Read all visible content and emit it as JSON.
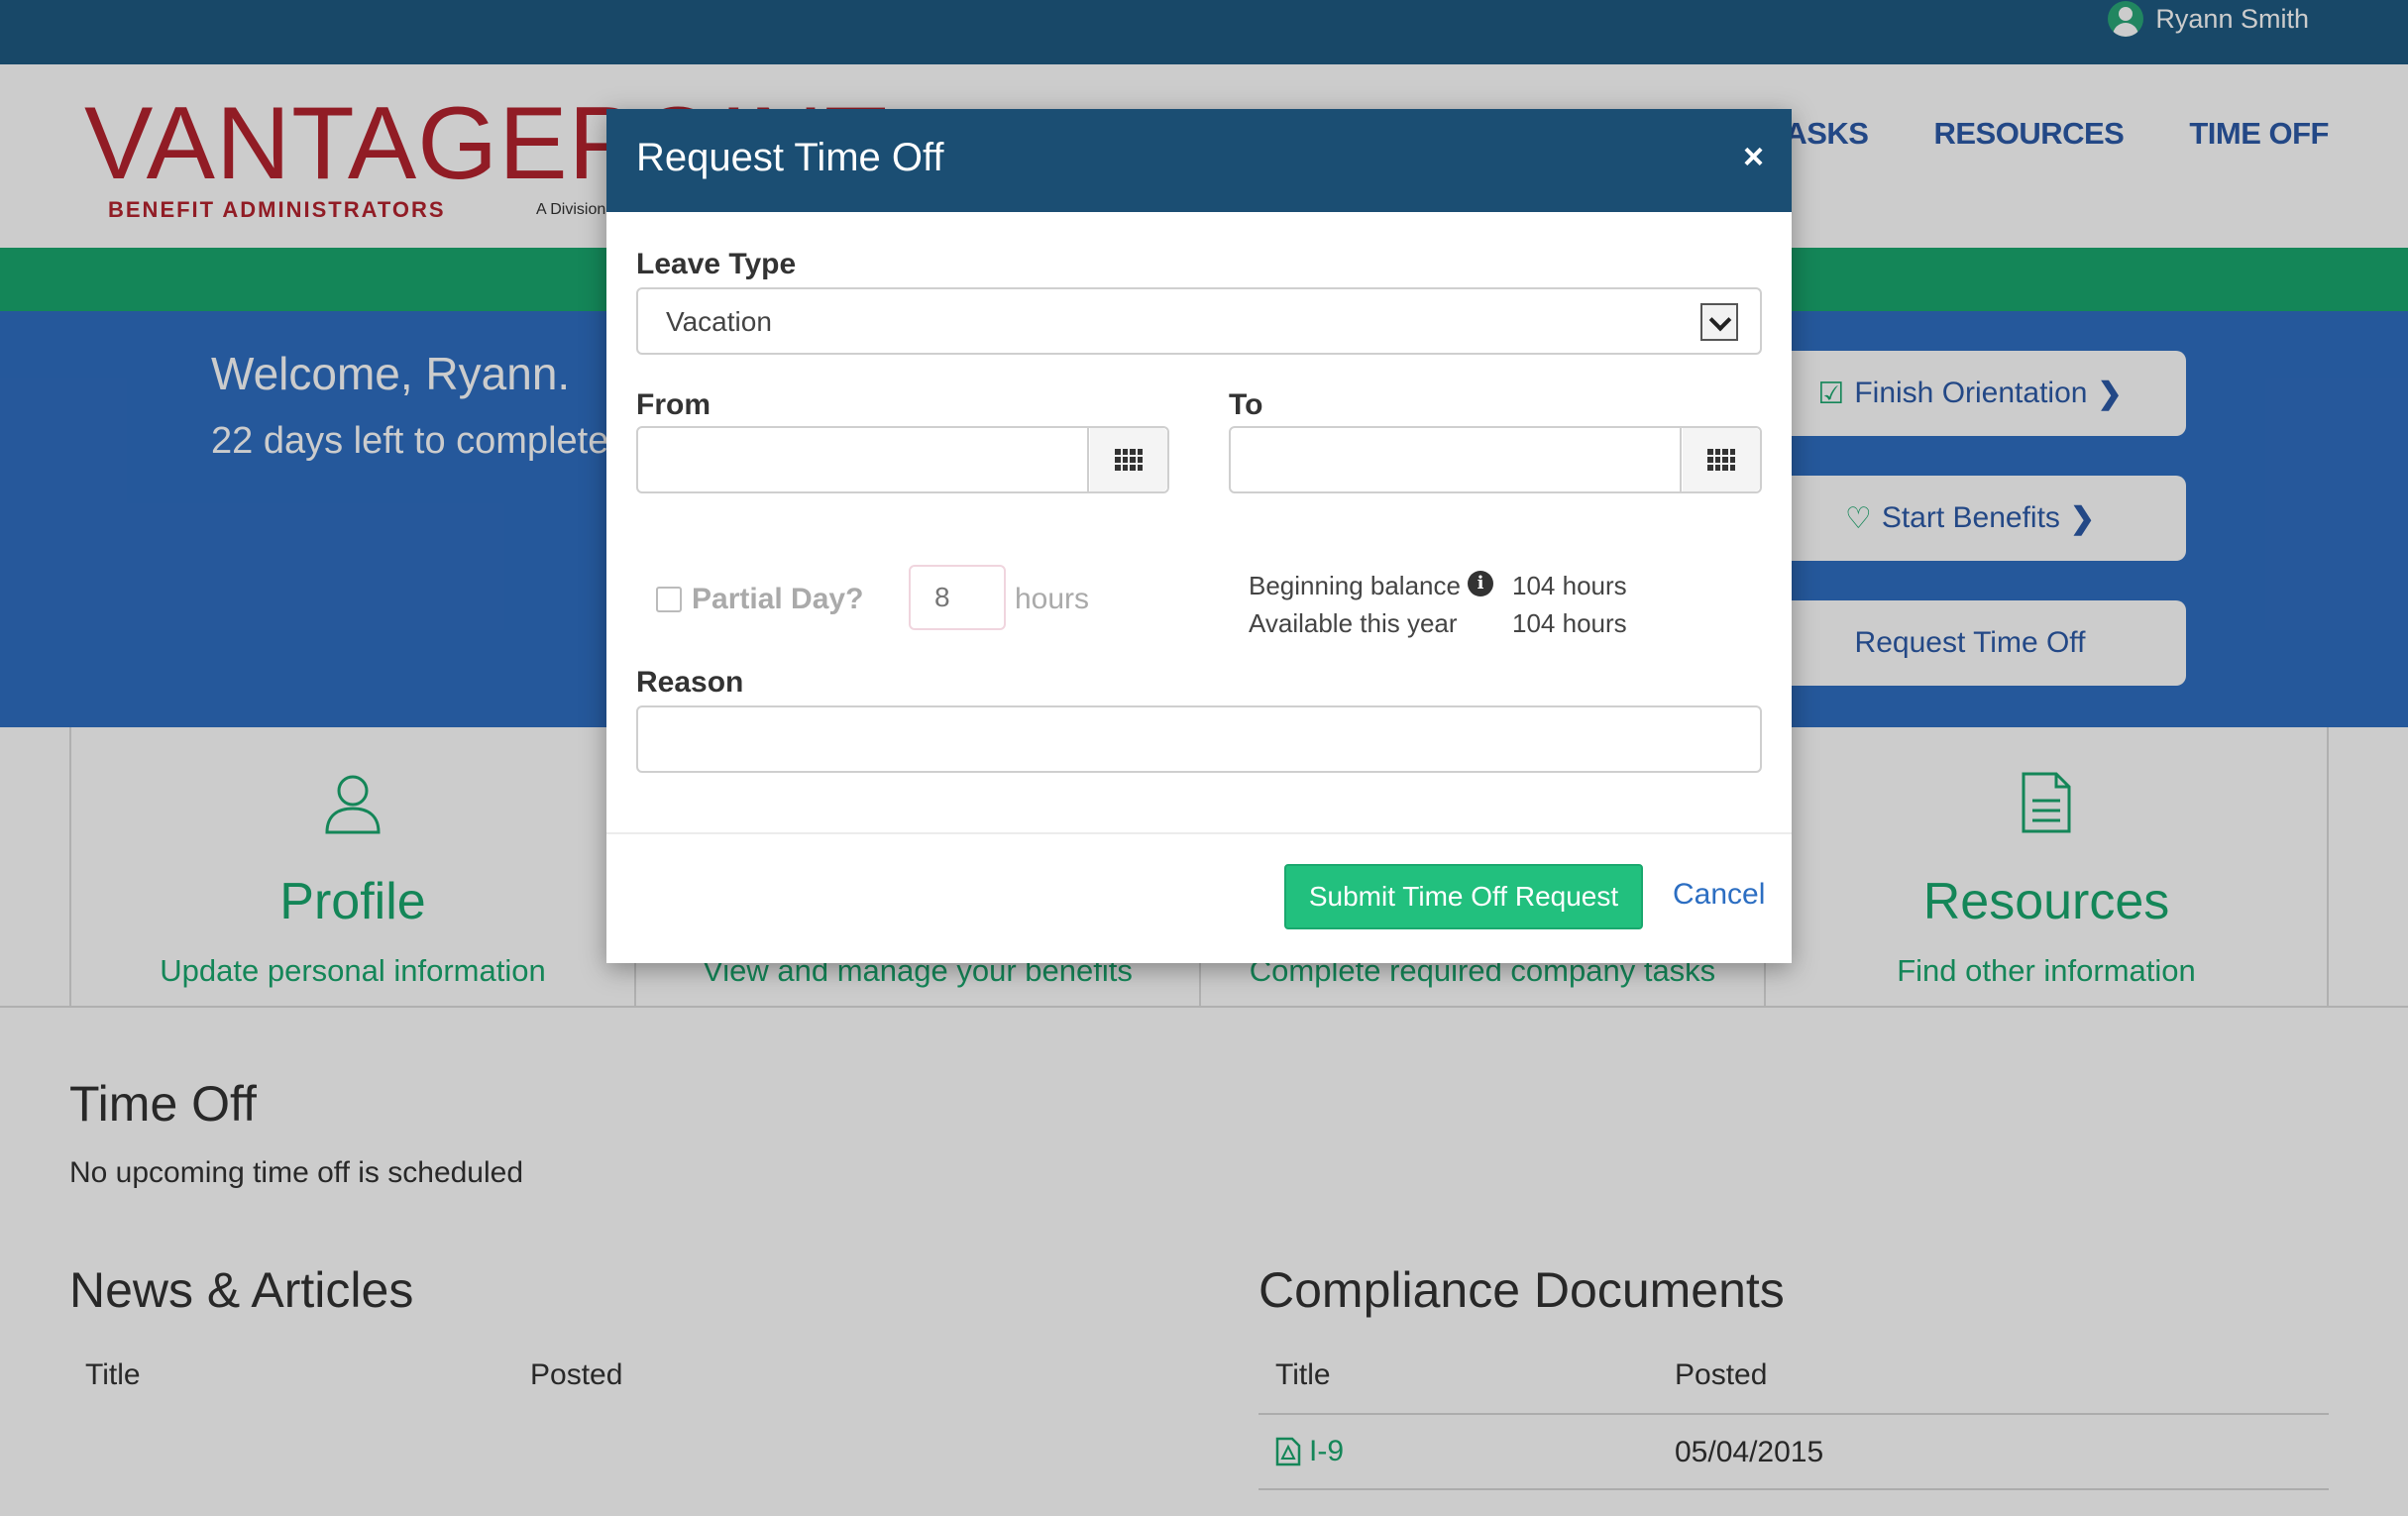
{
  "topbar": {
    "user_name": "Ryann Smith"
  },
  "header": {
    "logo_brand": "VANTAGEPOINT",
    "logo_tagline": "BENEFIT ADMINISTRATORS",
    "logo_division": "A Division",
    "nav": [
      {
        "label": "TASKS"
      },
      {
        "label": "RESOURCES"
      },
      {
        "label": "TIME OFF"
      }
    ]
  },
  "hero": {
    "welcome": "Welcome, Ryann.",
    "days_left": "22 days left to complete",
    "actions": [
      {
        "label": "Finish Orientation",
        "icon": "check-square-icon"
      },
      {
        "label": "Start Benefits",
        "icon": "heart-plus-icon"
      },
      {
        "label": "Request Time Off"
      }
    ]
  },
  "cards": [
    {
      "title": "Profile",
      "subtitle": "Update personal information",
      "icon": "person-icon"
    },
    {
      "title": "",
      "subtitle": "View and manage your benefits"
    },
    {
      "title": "",
      "subtitle": "Complete required company tasks"
    },
    {
      "title": "Resources",
      "subtitle": "Find other information",
      "icon": "document-icon"
    }
  ],
  "time_off": {
    "title": "Time Off",
    "message": "No upcoming time off is scheduled"
  },
  "news": {
    "title": "News & Articles",
    "columns": [
      "Title",
      "Posted"
    ]
  },
  "compliance": {
    "title": "Compliance Documents",
    "columns": [
      "Title",
      "Posted"
    ],
    "rows": [
      {
        "title": "I-9",
        "posted": "05/04/2015",
        "icon": "pdf-icon"
      }
    ]
  },
  "modal": {
    "title": "Request Time Off",
    "close": "×",
    "leave_type_label": "Leave Type",
    "leave_type_value": "Vacation",
    "from_label": "From",
    "to_label": "To",
    "from_value": "",
    "to_value": "",
    "partial_day_label": "Partial Day?",
    "partial_hours_placeholder": "8",
    "hours_label": "hours",
    "beginning_balance_label": "Beginning balance",
    "beginning_balance_value": "104 hours",
    "available_label": "Available this year",
    "available_value": "104 hours",
    "reason_label": "Reason",
    "reason_value": "",
    "submit_label": "Submit Time Off Request",
    "cancel_label": "Cancel"
  },
  "colors": {
    "topbar": "#1e5a82",
    "brand_red": "#b6242f",
    "green": "#1aa86e",
    "hero_blue": "#2f6ec2",
    "modal_header": "#1b4e73",
    "submit_green": "#22c07e"
  }
}
